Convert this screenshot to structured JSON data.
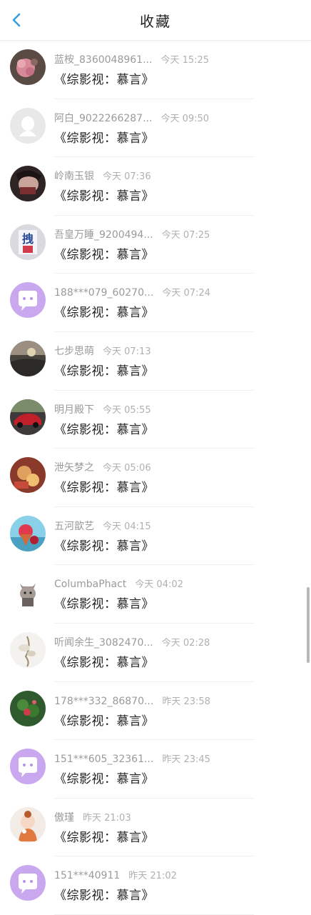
{
  "header": {
    "title": "收藏",
    "back_icon": "chevron-left-icon",
    "accent_color": "#3a9de0"
  },
  "items": [
    {
      "name": "蓝桉_8360048961...",
      "time": "今天 15:25",
      "book": "《综影视：慕言》",
      "avatar": "photo-flowers"
    },
    {
      "name": "阿白_9022266287...",
      "time": "今天 09:50",
      "book": "《综影视：慕言》",
      "avatar": "default-penguin"
    },
    {
      "name": "岭南玉银",
      "time": "今天 07:36",
      "book": "《综影视：慕言》",
      "avatar": "photo-portrait"
    },
    {
      "name": "吾皇万睡_9200494...",
      "time": "今天 07:25",
      "book": "《综影视：慕言》",
      "avatar": "photo-poster"
    },
    {
      "name": "188***079_60270...",
      "time": "今天 07:24",
      "book": "《综影视：慕言》",
      "avatar": "default-chat"
    },
    {
      "name": "七步思萌",
      "time": "今天 07:13",
      "book": "《综影视：慕言》",
      "avatar": "photo-landscape"
    },
    {
      "name": "明月殿下",
      "time": "今天 05:55",
      "book": "《综影视：慕言》",
      "avatar": "photo-car"
    },
    {
      "name": "泄矢梦之",
      "time": "今天 05:06",
      "book": "《综影视：慕言》",
      "avatar": "photo-anime"
    },
    {
      "name": "五河歆艺",
      "time": "今天 04:15",
      "book": "《综影视：慕言》",
      "avatar": "photo-icecream"
    },
    {
      "name": "ColumbaPhact",
      "time": "今天 04:02",
      "book": "《综影视：慕言》",
      "avatar": "photo-cat"
    },
    {
      "name": "听闻余生_3082470...",
      "time": "今天 02:28",
      "book": "《综影视：慕言》",
      "avatar": "photo-flower-white"
    },
    {
      "name": "178***332_86870...",
      "time": "昨天 23:58",
      "book": "《综影视：慕言》",
      "avatar": "photo-plant"
    },
    {
      "name": "151***605_32361...",
      "time": "昨天 23:45",
      "book": "《综影视：慕言》",
      "avatar": "default-chat"
    },
    {
      "name": "傲瑾",
      "time": "昨天 21:03",
      "book": "《综影视：慕言》",
      "avatar": "photo-doll"
    },
    {
      "name": "151***40911",
      "time": "昨天 21:02",
      "book": "《综影视：慕言》",
      "avatar": "default-chat"
    }
  ]
}
